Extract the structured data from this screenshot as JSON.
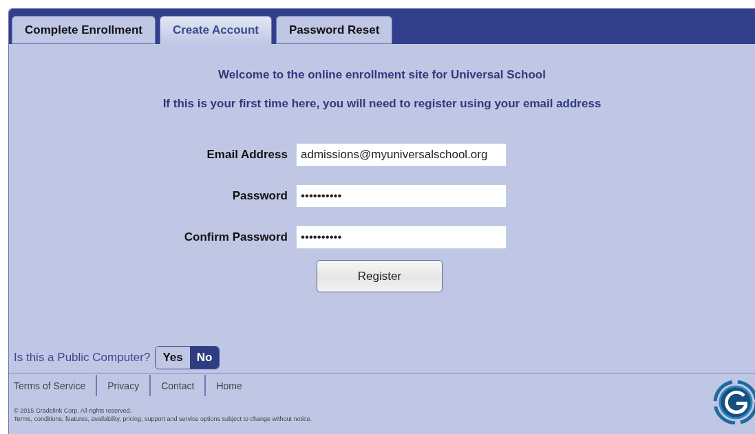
{
  "tabs": [
    {
      "label": "Complete Enrollment",
      "selected": false
    },
    {
      "label": "Create Account",
      "selected": true
    },
    {
      "label": "Password Reset",
      "selected": false
    }
  ],
  "intro": [
    "Welcome to the online enrollment site for Universal School",
    "If this is your first time here, you will need to register using your email address"
  ],
  "fields": [
    {
      "label": "Email Address",
      "value": "admissions@myuniversalschool.org"
    },
    {
      "label": "Password",
      "value": "••••••••••"
    },
    {
      "label": "Confirm Password",
      "value": "••••••••••"
    }
  ],
  "register_button": "Register",
  "public_computer": {
    "question": "Is this a Public Computer?",
    "options": [
      {
        "label": "Yes",
        "selected": false
      },
      {
        "label": "No",
        "selected": true
      }
    ]
  },
  "footer_links": [
    "Terms of Service",
    "Privacy",
    "Contact",
    "Home"
  ],
  "copyright": [
    "© 2015 Gradelink Corp. All rights reserved.",
    "Terms, conditions, features, availability, pricing, support and service options subject to change without notice."
  ]
}
